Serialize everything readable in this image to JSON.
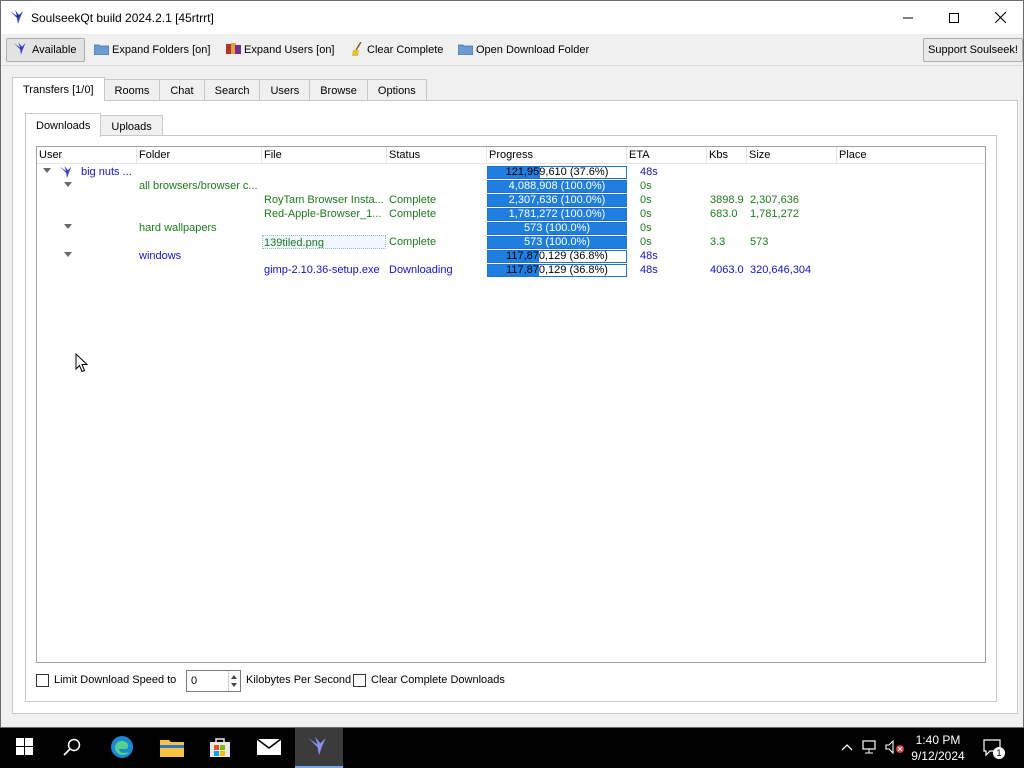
{
  "window": {
    "title": "SoulseekQt build 2024.2.1 [45rtrrt]"
  },
  "toolbar": {
    "status_label": "Available",
    "expand_folders_label": "Expand Folders [on]",
    "expand_users_label": "Expand Users [on]",
    "clear_complete_label": "Clear Complete",
    "open_download_folder_label": "Open Download Folder",
    "support_label": "Support Soulseek!"
  },
  "main_tabs": [
    "Transfers [1/0]",
    "Rooms",
    "Chat",
    "Search",
    "Users",
    "Browse",
    "Options"
  ],
  "sub_tabs": [
    "Downloads",
    "Uploads"
  ],
  "columns": [
    "User",
    "Folder",
    "File",
    "Status",
    "Progress",
    "ETA",
    "Kbs",
    "Size",
    "Place"
  ],
  "rows": [
    {
      "user": "big nuts ...",
      "folder": "",
      "file": "",
      "status": "",
      "progress_text": "121,959,610 (37.6%)",
      "progress": 0.376,
      "eta": "48s",
      "kbs": "",
      "size": "",
      "color": "blue"
    },
    {
      "user": "",
      "folder": "all browsers/browser c...",
      "file": "",
      "status": "",
      "progress_text": "4,088,908 (100.0%)",
      "progress": 1.0,
      "eta": "0s",
      "kbs": "",
      "size": "",
      "color": "green"
    },
    {
      "user": "",
      "folder": "",
      "file": "RoyTam Browser Insta...",
      "status": "Complete",
      "progress_text": "2,307,636 (100.0%)",
      "progress": 1.0,
      "eta": "0s",
      "kbs": "3898.9",
      "size": "2,307,636",
      "color": "green"
    },
    {
      "user": "",
      "folder": "",
      "file": "Red-Apple-Browser_1...",
      "status": "Complete",
      "progress_text": "1,781,272 (100.0%)",
      "progress": 1.0,
      "eta": "0s",
      "kbs": "683.0",
      "size": "1,781,272",
      "color": "green"
    },
    {
      "user": "",
      "folder": "hard wallpapers",
      "file": "",
      "status": "",
      "progress_text": "573 (100.0%)",
      "progress": 1.0,
      "eta": "0s",
      "kbs": "",
      "size": "",
      "color": "green"
    },
    {
      "user": "",
      "folder": "",
      "file": "139tiled.png",
      "status": "Complete",
      "progress_text": "573 (100.0%)",
      "progress": 1.0,
      "eta": "0s",
      "kbs": "3.3",
      "size": "573",
      "color": "green"
    },
    {
      "user": "",
      "folder": "windows",
      "file": "",
      "status": "",
      "progress_text": "117,870,129 (36.8%)",
      "progress": 0.368,
      "eta": "48s",
      "kbs": "",
      "size": "",
      "color": "blue"
    },
    {
      "user": "",
      "folder": "",
      "file": "gimp-2.10.36-setup.exe",
      "status": "Downloading",
      "progress_text": "117,870,129 (36.8%)",
      "progress": 0.368,
      "eta": "48s",
      "kbs": "4063.0",
      "size": "320,646,304",
      "color": "blue"
    }
  ],
  "bottom": {
    "limit_speed_label": "Limit Download Speed to",
    "speed_value": "0",
    "units_label": "Kilobytes Per Second",
    "clear_complete_downloads_label": "Clear Complete Downloads"
  },
  "taskbar": {
    "time": "1:40 PM",
    "date": "9/12/2024",
    "notification_count": "1"
  },
  "colors": {
    "blue_text": "#1515b8",
    "green_text": "#1f7a1f",
    "progress_fill": "#1e7fe0",
    "taskbar": "#000000"
  },
  "icons": [
    "soulseek-bird-icon",
    "folder-icon",
    "users-icon",
    "broom-icon",
    "minimize-icon",
    "maximize-icon",
    "close-icon",
    "windows-start-icon",
    "search-icon",
    "edge-icon",
    "file-explorer-icon",
    "store-icon",
    "mail-icon",
    "chevron-up-icon",
    "network-icon",
    "volume-muted-icon",
    "notification-icon"
  ]
}
